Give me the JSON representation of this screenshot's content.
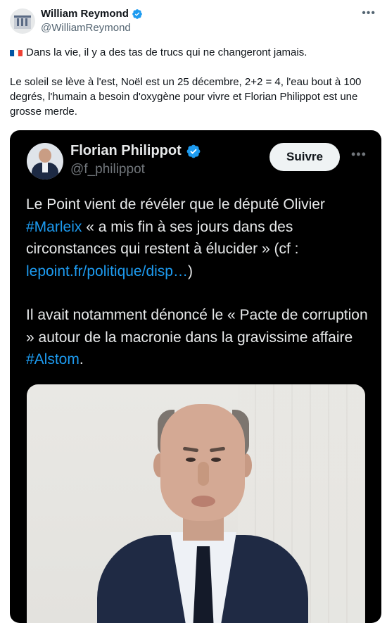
{
  "tweet": {
    "author_name": "William Reymond",
    "author_handle": "@WilliamReymond",
    "more_icon": "•••",
    "line1": "Dans la vie, il y  a des tas de trucs qui ne changeront jamais.",
    "line2": "Le soleil se lève à l'est, Noël est un 25 décembre, 2+2 = 4, l'eau bout à 100 degrés, l'humain a besoin d'oxygène pour vivre et Florian Philippot est une grosse merde."
  },
  "quoted": {
    "author_name": "Florian Philippot",
    "author_handle": "@f_philippot",
    "follow_label": "Suivre",
    "more_icon": "•••",
    "p1_a": "Le Point vient de révéler que le député Olivier ",
    "p1_hashtag": "#Marleix",
    "p1_b": " « a mis fin à ses jours dans des circonstances qui restent à élucider » (cf : ",
    "p1_link": "lepoint.fr/politique/disp…",
    "p1_c": ")",
    "p2_a": "Il avait notamment dénoncé le « Pacte de corruption » autour de la macronie dans la gravissime affaire ",
    "p2_hashtag": "#Alstom",
    "p2_b": "."
  },
  "colors": {
    "link": "#1d9bf0",
    "verified": "#1d9bf0",
    "flag": [
      "#0055a4",
      "#ffffff",
      "#ef4135"
    ]
  }
}
